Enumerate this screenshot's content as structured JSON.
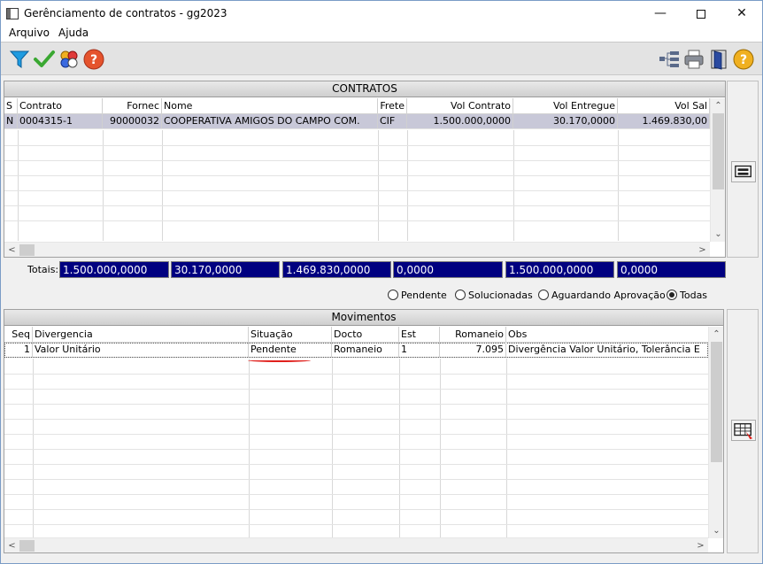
{
  "window": {
    "title": "Gerênciamento de contratos - gg2023"
  },
  "menu": {
    "items": [
      "Arquivo",
      "Ajuda"
    ]
  },
  "toolbar": {
    "left_icons": [
      "filter-icon",
      "check-icon",
      "circles-icon",
      "help-icon"
    ],
    "right_icons": [
      "tree-icon",
      "print-icon",
      "exit-door-icon",
      "help-icon"
    ]
  },
  "contratos": {
    "title": "CONTRATOS",
    "columns": [
      "S",
      "Contrato",
      "Fornec",
      "Nome",
      "Frete",
      "Vol Contrato",
      "Vol Entregue",
      "Vol Sal"
    ],
    "rows": [
      [
        "N",
        "0004315-1",
        "90000032",
        "COOPERATIVA AMIGOS DO CAMPO COM.",
        "CIF",
        "1.500.000,0000",
        "30.170,0000",
        "1.469.830,00"
      ]
    ]
  },
  "totais": {
    "label": "Totais:",
    "values": [
      "1.500.000,0000",
      "30.170,0000",
      "1.469.830,0000",
      "0,0000",
      "1.500.000,0000",
      "0,0000"
    ]
  },
  "filter": {
    "options": [
      "Pendente",
      "Solucionadas",
      "Aguardando Aprovação",
      "Todas"
    ],
    "selected": "Todas"
  },
  "movimentos": {
    "title": "Movimentos",
    "columns": [
      "Seq",
      "Divergencia",
      "Situação",
      "Docto",
      "Est",
      "Romaneio",
      "Obs"
    ],
    "rows": [
      [
        "1",
        "Valor Unitário",
        "Pendente",
        "Romaneio",
        "1",
        "7.095",
        "Divergência Valor Unitário, Tolerância E"
      ]
    ]
  },
  "colors": {
    "totals_bg": "#000080",
    "selected_row": "#c8c8d8",
    "annotation": "#e0201c"
  }
}
